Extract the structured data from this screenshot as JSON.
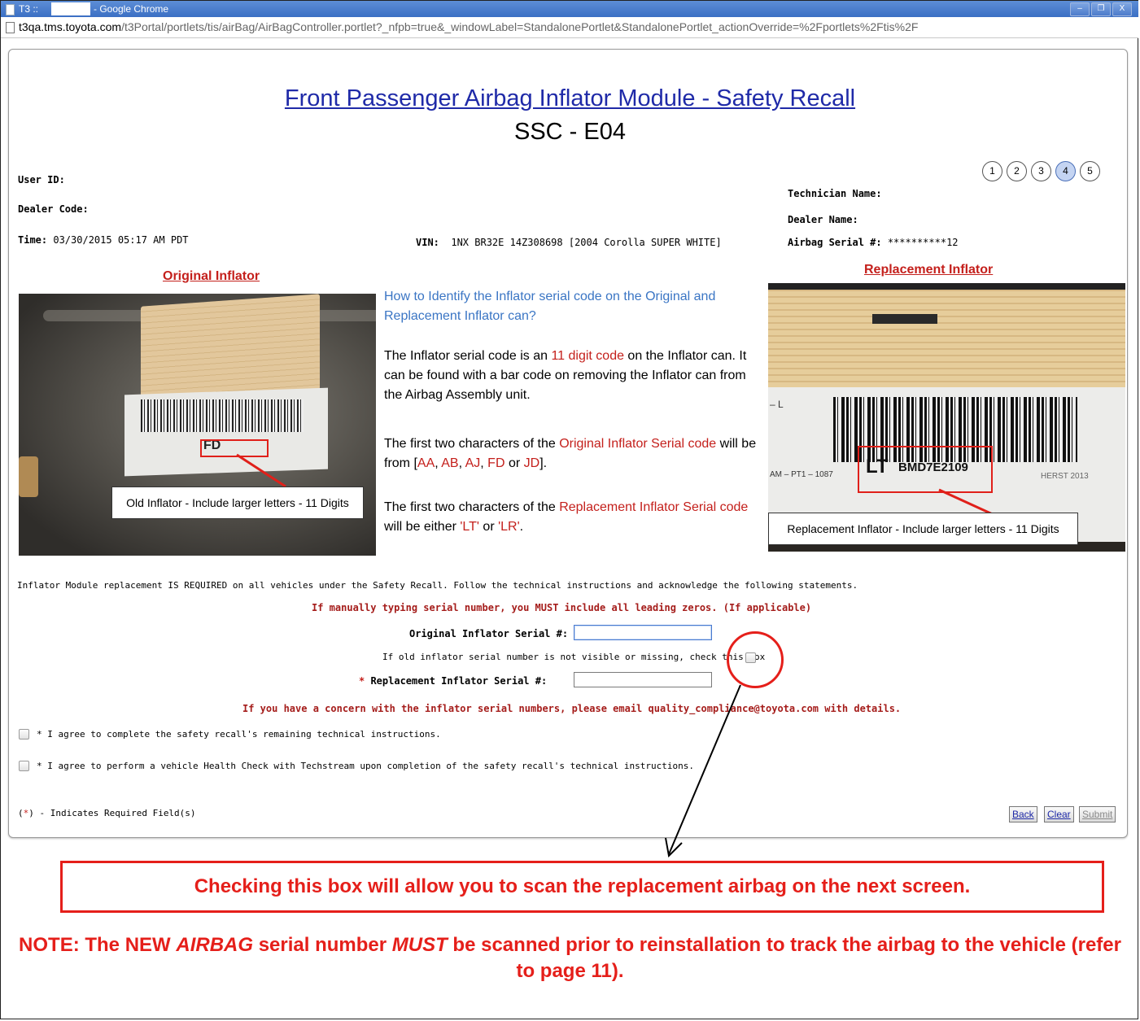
{
  "window": {
    "title_prefix": "T3 ::",
    "title_suffix": "- Google Chrome",
    "controls": [
      "–",
      "❐",
      "X"
    ]
  },
  "address_bar": {
    "host": "t3qa.tms.toyota.com",
    "path": "/t3Portal/portlets/tis/airBag/AirBagController.portlet?_nfpb=true&_windowLabel=StandalonePortlet&StandalonePortlet_actionOverride=%2Fportlets%2Ftis%2F"
  },
  "page": {
    "title": "Front Passenger Airbag Inflator Module - Safety Recall",
    "subtitle": "SSC - E04"
  },
  "steps": {
    "items": [
      "1",
      "2",
      "3",
      "4",
      "5"
    ],
    "active": "4"
  },
  "info": {
    "user_id_label": "User ID:",
    "dealer_code_label": "Dealer Code:",
    "time_label": "Time:",
    "time_value": "03/30/2015 05:17 AM PDT",
    "vin_label": "VIN:",
    "vin_value": "1NX BR32E 14Z308698 [2004 Corolla SUPER WHITE]",
    "technician_label": "Technician Name:",
    "dealer_name_label": "Dealer Name:",
    "airbag_serial_label": "Airbag Serial #:",
    "airbag_serial_value": "**********12"
  },
  "original": {
    "heading": "Original Inflator",
    "caption": "Old Inflator - Include larger letters - 11 Digits",
    "photo_code": "FD"
  },
  "replacement": {
    "heading": "Replacement Inflator",
    "caption": "Replacement Inflator - Include larger letters - 11 Digits",
    "photo_lt": "LT",
    "photo_serial": "BMD7E2109",
    "photo_left": "AM – PT1 – 1087",
    "photo_right": "HERST 2013",
    "photo_minus_l": "– L"
  },
  "instructions": {
    "question": "How to Identify the Inflator serial code on the Original and Replacement Inflator can?",
    "p1_a": "The Inflator serial code is an ",
    "p1_red": "11 digit code",
    "p1_b": " on the Inflator can. It can be found with a bar code on removing the Inflator can from the Airbag Assembly unit.",
    "p2_a": "The first two characters of the ",
    "p2_red": "Original Inflator Serial code",
    "p2_b": " will be from [",
    "p2_codes": [
      "AA",
      "AB",
      "AJ",
      "FD",
      "JD"
    ],
    "p2_or": " or ",
    "p2_end": "].",
    "p3_a": "The first two characters of the ",
    "p3_red": "Replacement Inflator Serial code",
    "p3_b": " will be either ",
    "p3_code1": "'LT'",
    "p3_or": " or ",
    "p3_code2": "'LR'",
    "p3_end": "."
  },
  "form": {
    "notice": "Inflator Module replacement IS REQUIRED on all vehicles under the Safety Recall. Follow the technical instructions and acknowledge the following statements.",
    "leading_zeros": "If manually typing serial number, you MUST include all leading zeros. (If applicable)",
    "original_serial_label": "Original Inflator Serial #:",
    "original_serial_value": "",
    "missing_label": "If old inflator serial number is not visible or missing, check this box",
    "replacement_required_mark": "*",
    "replacement_serial_label": " Replacement Inflator Serial #:",
    "replacement_serial_value": "",
    "concern": "If you have a concern with the inflator serial numbers, please email quality_compliance@toyota.com with details.",
    "agree1": "* I agree to complete the safety recall's remaining technical instructions.",
    "agree2": "* I agree to perform a vehicle Health Check with Techstream upon completion of the safety recall's technical instructions.",
    "required_open": "(",
    "required_star": "*",
    "required_rest": ") - Indicates Required Field(s)",
    "buttons": {
      "back": "Back",
      "clear": "Clear",
      "submit": "Submit"
    }
  },
  "annotations": {
    "box_text": "Checking this box will allow you to scan the replacement airbag on the next screen.",
    "note_a": "NOTE: The NEW ",
    "note_airbag": "AIRBAG",
    "note_b": " serial number ",
    "note_must": "MUST",
    "note_c": " be scanned prior to reinstallation to track the airbag to the vehicle (refer to page 11).",
    "color": "#e51f1a"
  }
}
